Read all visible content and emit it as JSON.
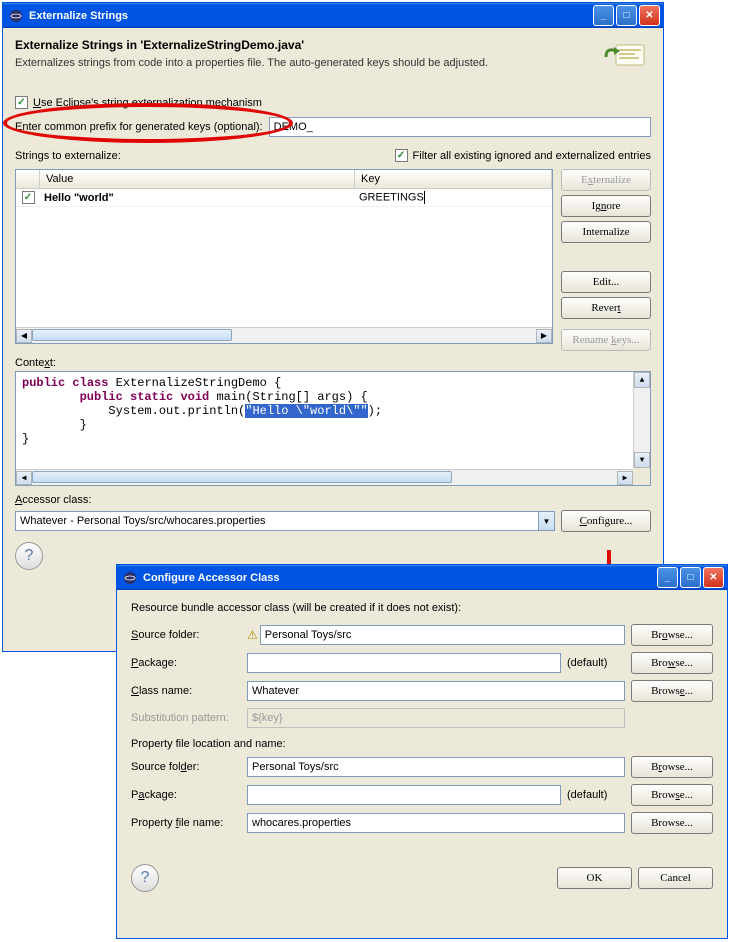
{
  "window1": {
    "title": "Externalize Strings",
    "heading": "Externalize Strings in 'ExternalizeStringDemo.java'",
    "subheading": "Externalizes strings from code into a properties file. The auto-generated keys should be adjusted.",
    "mechanism_checkbox_label": "Use Eclipse's string externalization mechanism",
    "mechanism_checked": true,
    "prefix_label": "Enter common prefix for generated keys (optional):",
    "prefix_value": "DEMO_",
    "strings_label": "Strings to externalize:",
    "filter_label": "Filter all existing ignored and externalized entries",
    "filter_checked": true,
    "columns": {
      "col1": "Value",
      "col2": "Key"
    },
    "rows": [
      {
        "checked": true,
        "value": "Hello \"world\"",
        "key": "GREETINGS"
      }
    ],
    "buttons": {
      "externalize": "Externalize",
      "ignore": "Ignore",
      "internalize": "Internalize",
      "edit": "Edit...",
      "revert": "Revert",
      "rename": "Rename keys..."
    },
    "context_label": "Context:",
    "code": {
      "l1a": "public",
      "l1b": "class",
      "l1c": " ExternalizeStringDemo {",
      "l2a": "public",
      "l2b": "static",
      "l2c": "void",
      "l2d": " main(String[] args) {",
      "l3a": "            System.out.println(",
      "l3b": "\"Hello \\\"world\\\"\"",
      "l3c": ");",
      "l4": "        }",
      "l5": "}"
    },
    "accessor_label": "Accessor class:",
    "accessor_value": "Whatever - Personal Toys/src/whocares.properties",
    "configure_btn": "Configure..."
  },
  "window2": {
    "title": "Configure Accessor Class",
    "heading": "Resource bundle accessor class (will be created if it does not exist):",
    "source_folder_label": "Source folder:",
    "source_folder_value": "Personal Toys/src",
    "package_label": "Package:",
    "package_value": "",
    "package_default": "(default)",
    "class_label": "Class name:",
    "class_value": "Whatever",
    "subst_label": "Substitution pattern:",
    "subst_value": "${key}",
    "section2": "Property file location and name:",
    "source_folder2_value": "Personal Toys/src",
    "package2_value": "",
    "prop_file_label": "Property file name:",
    "prop_file_value": "whocares.properties",
    "browse": "Browse...",
    "ok": "OK",
    "cancel": "Cancel"
  }
}
